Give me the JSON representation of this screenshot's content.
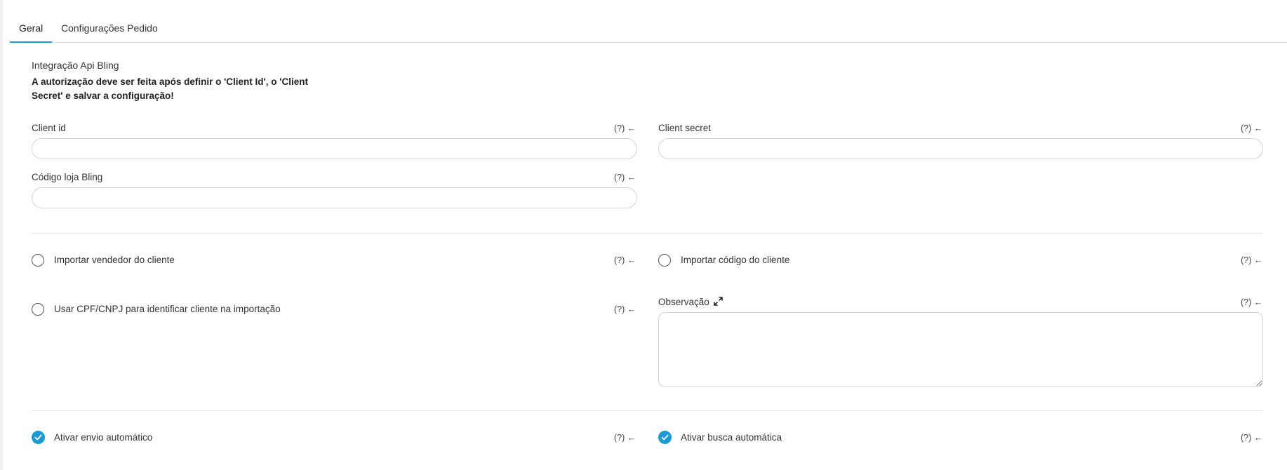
{
  "tabs": [
    {
      "label": "Geral",
      "active": true
    },
    {
      "label": "Configurações Pedido",
      "active": false
    }
  ],
  "section": {
    "title": "Integração Api Bling",
    "notice": "A autorização deve ser feita após definir o 'Client Id', o 'Client Secret' e salvar a configuração!"
  },
  "help_label": "(?) ←",
  "fields": {
    "client_id": {
      "label": "Client id",
      "value": ""
    },
    "client_secret": {
      "label": "Client secret",
      "value": ""
    },
    "codigo_loja": {
      "label": "Código loja Bling",
      "value": ""
    },
    "observacao": {
      "label": "Observação",
      "value": ""
    }
  },
  "options": {
    "importar_vendedor": {
      "label": "Importar vendedor do cliente",
      "checked": false
    },
    "importar_codigo": {
      "label": "Importar código do cliente",
      "checked": false
    },
    "usar_cpf": {
      "label": "Usar CPF/CNPJ para identificar cliente na importação",
      "checked": false
    },
    "ativar_envio": {
      "label": "Ativar envio automático",
      "checked": true
    },
    "ativar_busca": {
      "label": "Ativar busca automática",
      "checked": true
    }
  },
  "colors": {
    "accent": "#1a9ad6"
  },
  "icons": {
    "expand": "expand-arrows-icon",
    "check": "checkmark-icon"
  }
}
